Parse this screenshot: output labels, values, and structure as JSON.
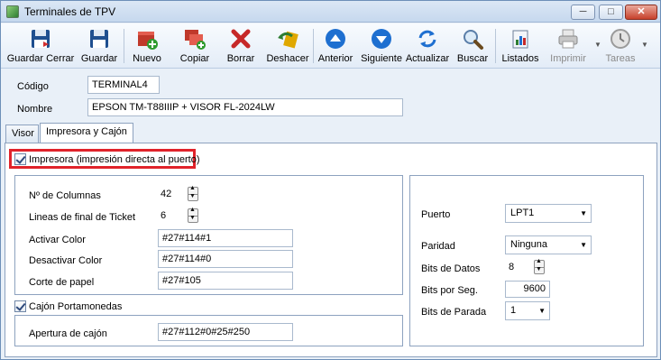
{
  "window": {
    "title": "Terminales de TPV",
    "min_symbol": "─",
    "max_symbol": "□",
    "close_symbol": "✕"
  },
  "toolbar": [
    {
      "label": "Guardar Cerrar",
      "icon": "save-close-icon",
      "enabled": true
    },
    {
      "label": "Guardar",
      "icon": "save-icon",
      "enabled": true
    },
    {
      "label": "Nuevo",
      "icon": "new-icon",
      "enabled": true
    },
    {
      "label": "Copiar",
      "icon": "copy-icon",
      "enabled": true
    },
    {
      "label": "Borrar",
      "icon": "delete-icon",
      "enabled": true
    },
    {
      "label": "Deshacer",
      "icon": "undo-icon",
      "enabled": true
    },
    {
      "label": "Anterior",
      "icon": "previous-icon",
      "enabled": true
    },
    {
      "label": "Siguiente",
      "icon": "next-icon",
      "enabled": true
    },
    {
      "label": "Actualizar",
      "icon": "refresh-icon",
      "enabled": true
    },
    {
      "label": "Buscar",
      "icon": "search-icon",
      "enabled": true
    },
    {
      "label": "Listados",
      "icon": "reports-icon",
      "enabled": true
    },
    {
      "label": "Imprimir",
      "icon": "print-icon",
      "enabled": false
    },
    {
      "label": "Tareas",
      "icon": "tasks-icon",
      "enabled": false
    }
  ],
  "header": {
    "codigo_label": "Código",
    "codigo_value": "TERMINAL4",
    "nombre_label": "Nombre",
    "nombre_value": "EPSON TM-T88IIIP + VISOR FL-2024LW"
  },
  "tabs": [
    {
      "label": "Visor",
      "active": false
    },
    {
      "label": "Impresora y Cajón",
      "active": true
    }
  ],
  "impresora": {
    "checkbox_label": "Impresora (impresión directa al puerto)",
    "checked": true,
    "columnas_label": "Nº de Columnas",
    "columnas_value": "42",
    "lineas_label": "Lineas de final de Ticket",
    "lineas_value": "6",
    "activar_label": "Activar Color",
    "activar_value": "#27#114#1",
    "desactivar_label": "Desactivar Color",
    "desactivar_value": "#27#114#0",
    "corte_label": "Corte de papel",
    "corte_value": "#27#105"
  },
  "cajon": {
    "checkbox_label": "Cajón Portamonedas",
    "checked": true,
    "apertura_label": "Apertura de cajón",
    "apertura_value": "#27#112#0#25#250"
  },
  "puerto": {
    "puerto_label": "Puerto",
    "puerto_value": "LPT1",
    "paridad_label": "Paridad",
    "paridad_value": "Ninguna",
    "bits_datos_label": "Bits de Datos",
    "bits_datos_value": "8",
    "bits_seg_label": "Bits por Seg.",
    "bits_seg_value": "9600",
    "bits_parada_label": "Bits de Parada",
    "bits_parada_value": "1"
  }
}
